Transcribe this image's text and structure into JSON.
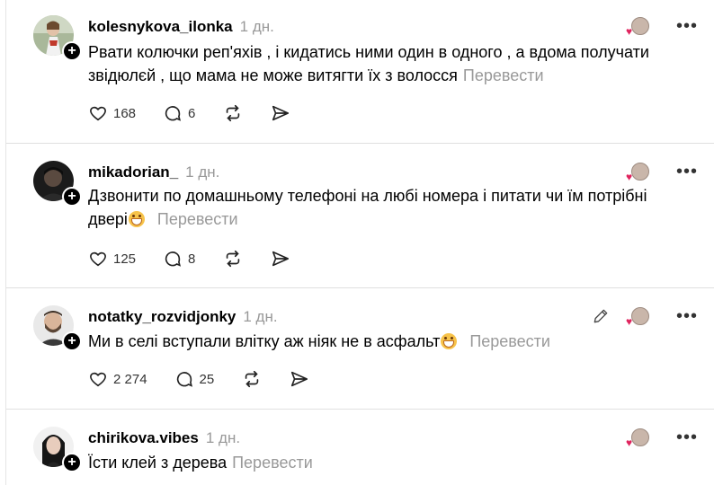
{
  "posts": [
    {
      "username": "kolesnykova_ilonka",
      "time": "1 дн.",
      "text_line1": "Рвати колючки реп'яхів , і кидатись ними один в одного , а вдома получати",
      "text_line2": "звідюлєй , що мама не може витягти їх з волосся",
      "translate": "Перевести",
      "likes": "168",
      "replies": "6"
    },
    {
      "username": "mikadorian_",
      "time": "1 дн.",
      "text_line1": "Дзвонити по домашньому телефоні на любі номера і питати чи їм потрібні",
      "text_line2": "двері",
      "translate": "Перевести",
      "likes": "125",
      "replies": "8"
    },
    {
      "username": "notatky_rozvidjonky",
      "time": "1 дн.",
      "text_line1": "Ми в селі вступали влітку аж ніяк не в асфальт",
      "translate": "Перевести",
      "likes": "2 274",
      "replies": "25"
    },
    {
      "username": "chirikova.vibes",
      "time": "1 дн.",
      "text_line1": "Їсти клей з дерева",
      "translate": "Перевести"
    }
  ],
  "colors": {
    "muted": "#999999",
    "heart": "#e0245e",
    "divider": "#e0e0e0"
  }
}
